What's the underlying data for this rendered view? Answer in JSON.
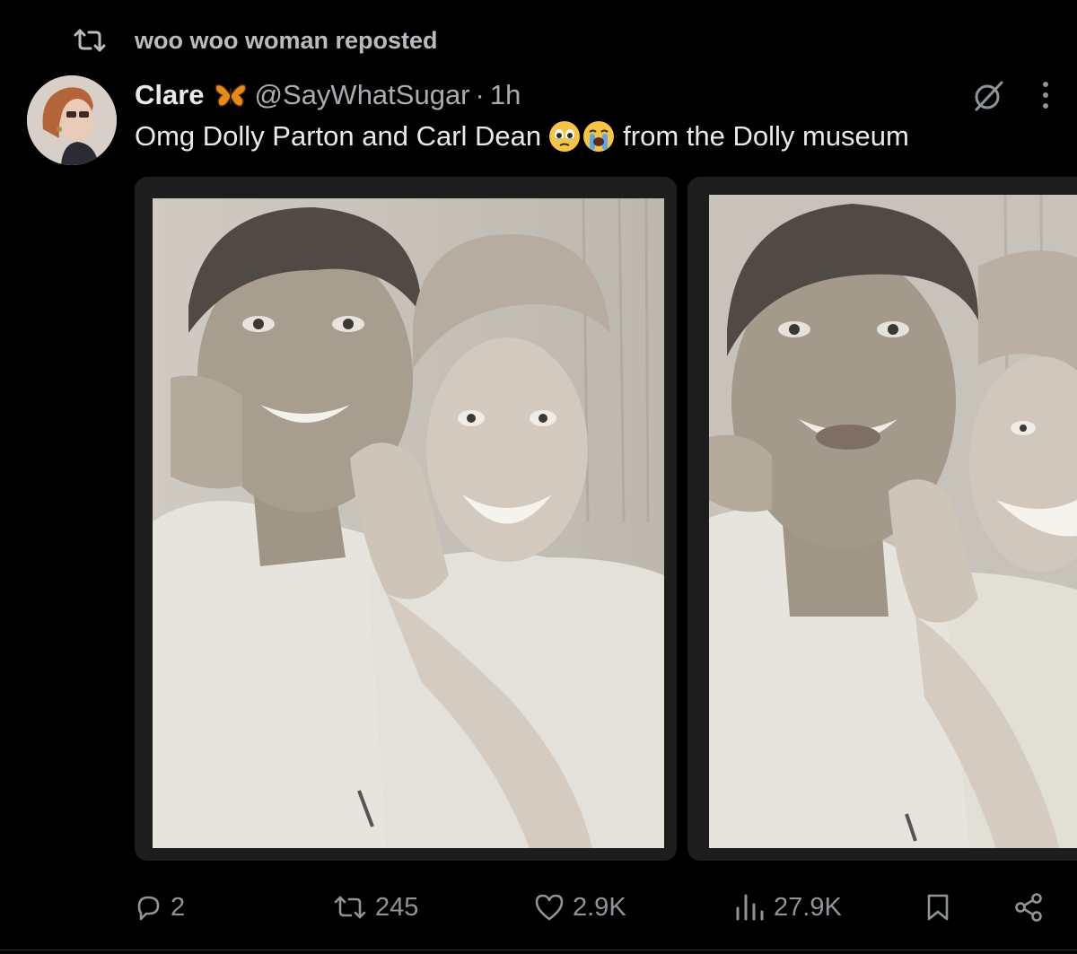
{
  "repost": {
    "icon": "repost-icon",
    "text": "woo woo woman reposted"
  },
  "author": {
    "name": "Clare",
    "badge_icon": "butterfly-icon",
    "handle": "@SayWhatSugar",
    "separator": "·",
    "time": "1h"
  },
  "tweet": {
    "text_before": "Omg Dolly Parton and Carl Dean",
    "emojis": [
      "holding-back-tears-emoji",
      "loudly-crying-emoji"
    ],
    "text_after": "from the Dolly museum"
  },
  "media": {
    "count_shown": 2,
    "items": [
      "photo-booth-strip-1",
      "photo-booth-strip-2"
    ]
  },
  "actions": {
    "replies": "2",
    "reposts": "245",
    "likes": "2.9K",
    "views": "27.9K"
  },
  "colors": {
    "background": "#000000",
    "text_primary": "#e7e9ea",
    "text_secondary": "#8f9499"
  }
}
